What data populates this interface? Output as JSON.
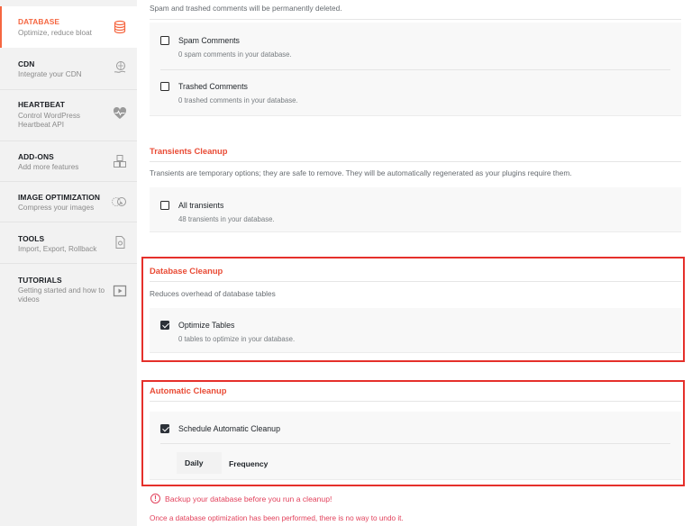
{
  "sidebar": {
    "items": [
      {
        "title": "DATABASE",
        "desc": "Optimize, reduce bloat",
        "icon": "database-icon",
        "active": true
      },
      {
        "title": "CDN",
        "desc": "Integrate your CDN",
        "icon": "cdn-icon"
      },
      {
        "title": "HEARTBEAT",
        "desc": "Control WordPress Heartbeat API",
        "icon": "heartbeat-icon"
      },
      {
        "title": "ADD-ONS",
        "desc": "Add more features",
        "icon": "addons-icon"
      },
      {
        "title": "IMAGE OPTIMIZATION",
        "desc": "Compress your images",
        "icon": "image-optimization-icon"
      },
      {
        "title": "TOOLS",
        "desc": "Import, Export, Rollback",
        "icon": "tools-icon"
      },
      {
        "title": "TUTORIALS",
        "desc": "Getting started and how to videos",
        "icon": "tutorials-icon"
      }
    ]
  },
  "main": {
    "spam_note": "Spam and trashed comments will be permanently deleted.",
    "spam": {
      "label": "Spam Comments",
      "desc": "0 spam comments in your database.",
      "checked": false
    },
    "trashed": {
      "label": "Trashed Comments",
      "desc": "0 trashed comments in your database.",
      "checked": false
    },
    "transients": {
      "title": "Transients Cleanup",
      "desc": "Transients are temporary options; they are safe to remove. They will be automatically regenerated as your plugins require them.",
      "all": {
        "label": "All transients",
        "desc": "48 transients in your database.",
        "checked": false
      }
    },
    "db_cleanup": {
      "title": "Database Cleanup",
      "desc": "Reduces overhead of database tables",
      "optimize": {
        "label": "Optimize Tables",
        "desc": "0 tables to optimize in your database.",
        "checked": true
      }
    },
    "auto_cleanup": {
      "title": "Automatic Cleanup",
      "schedule": {
        "label": "Schedule Automatic Cleanup",
        "checked": true
      },
      "frequency_value": "Daily",
      "frequency_label": "Frequency"
    },
    "warning": "Backup your database before you run a cleanup!",
    "warning_icon": "!",
    "note": "Once a database optimization has been performed, there is no way to undo it."
  },
  "colors": {
    "accent": "#f56640",
    "section_title": "#e94b35",
    "highlight_box": "#e5302b",
    "warning": "#e2425c"
  }
}
